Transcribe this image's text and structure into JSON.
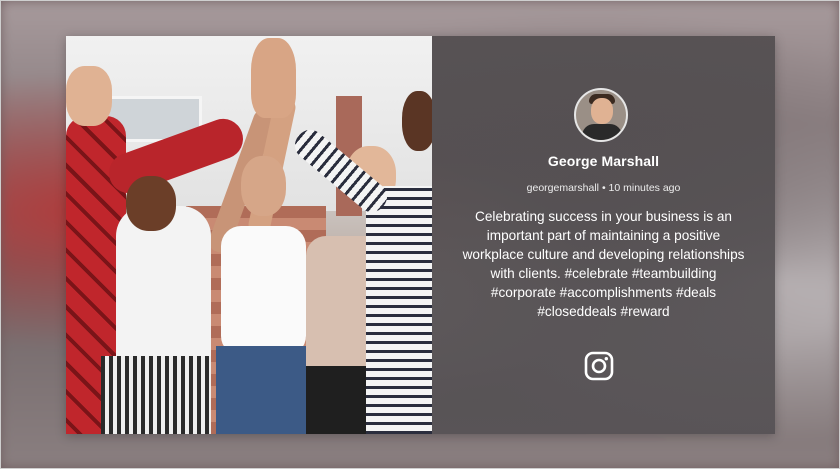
{
  "post": {
    "author_name": "George Marshall",
    "handle": "georgemarshall",
    "separator": "•",
    "time_ago": "10 minutes ago",
    "text": "Celebrating success in your business is an important part of maintaining a positive workplace culture and developing relationships with clients. #celebrate #teambuilding #corporate #accomplishments #deals #closeddeals #reward",
    "platform_icon": "instagram-icon"
  },
  "colors": {
    "panel_bg": "#4e4a4c",
    "text": "#ffffff"
  }
}
